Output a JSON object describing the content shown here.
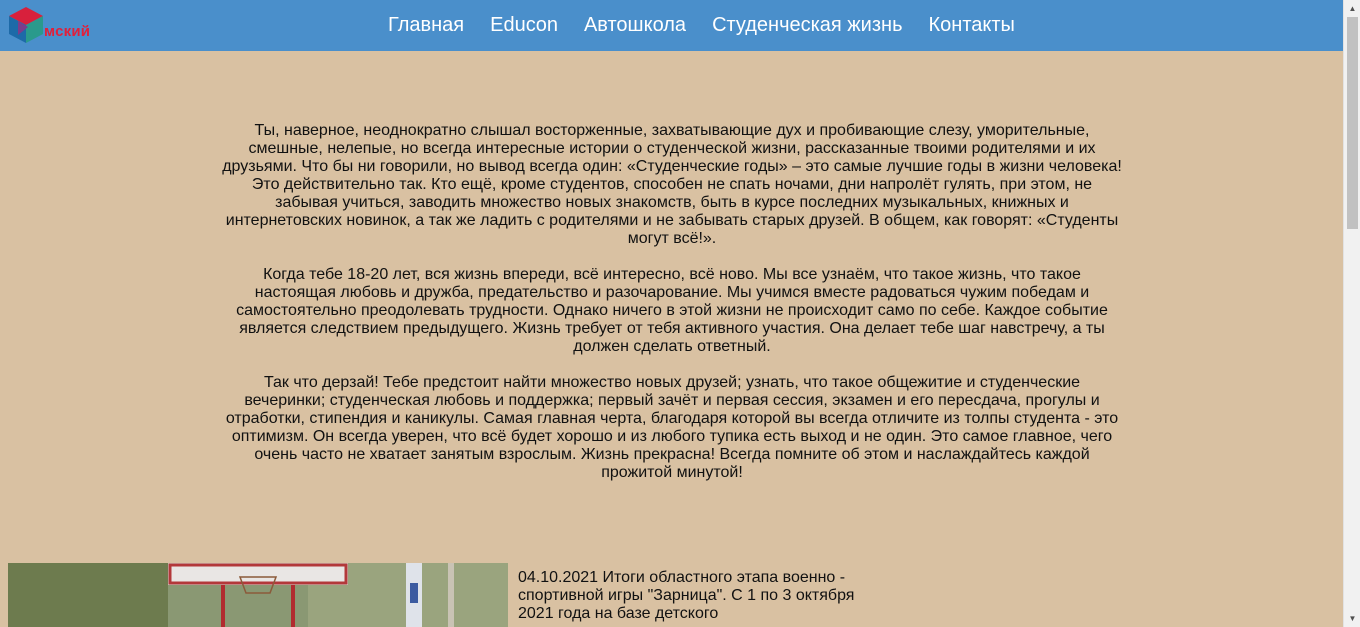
{
  "header": {
    "logo_text": "мский",
    "logo_subtext": "",
    "nav": [
      "Главная",
      "Educon",
      "Автошкола",
      "Студенческая жизнь",
      "Контакты"
    ]
  },
  "content": {
    "paragraphs": [
      "Ты, наверное, неоднократно слышал восторженные, захватывающие дух и пробивающие слезу, уморительные, смешные, нелепые, но всегда интересные истории о студенческой жизни, рассказанные твоими родителями и их друзьями. Что бы ни говорили, но вывод всегда один: «Студенческие годы» – это самые лучшие годы в жизни человека! Это действительно так. Кто ещё, кроме студентов, способен не спать ночами, дни напролёт гулять, при этом, не забывая учиться, заводить множество новых знакомств, быть в курсе последних музыкальных, книжных и интернетовских новинок, а так же ладить с родителями и не забывать старых друзей. В общем, как говорят: «Студенты могут всё!».",
      "Когда тебе 18-20 лет, вся жизнь впереди, всё интересно, всё ново. Мы все узнаём, что такое жизнь, что такое настоящая любовь и дружба, предательство и разочарование. Мы учимся вместе радоваться чужим победам и самостоятельно преодолевать трудности. Однако ничего в этой жизни не происходит само по себе. Каждое событие является следствием предыдущего. Жизнь требует от тебя активного участия. Она делает тебе шаг навстречу, а ты должен сделать ответный.",
      "Так что дерзай! Тебе предстоит найти множество новых друзей; узнать, что такое общежитие и студенческие вечеринки; студенческая любовь и поддержка; первый зачёт и первая сессия, экзамен и его пересдача, прогулы и отработки, стипендия и каникулы. Самая главная черта, благодаря которой вы всегда отличите из толпы студента - это оптимизм. Он всегда уверен, что всё будет хорошо и из любого тупика есть выход и не один. Это самое главное, чего очень часто не хватает занятым взрослым. Жизнь прекрасна! Всегда помните об этом и наслаждайтесь каждой прожитой минутой!"
    ]
  },
  "news": {
    "text": "04.10.2021 Итоги областного этапа военно - спортивной игры \"Зарница\". С 1 по 3 октября 2021 года на базе детского"
  },
  "colors": {
    "header_bg": "#4a8fcb",
    "page_bg": "#d9c1a2",
    "logo_red": "#e0203b"
  },
  "icons": {
    "logo": "cube-logo-icon",
    "scroll_up": "scroll-up-arrow-icon",
    "scroll_down": "scroll-down-arrow-icon"
  }
}
